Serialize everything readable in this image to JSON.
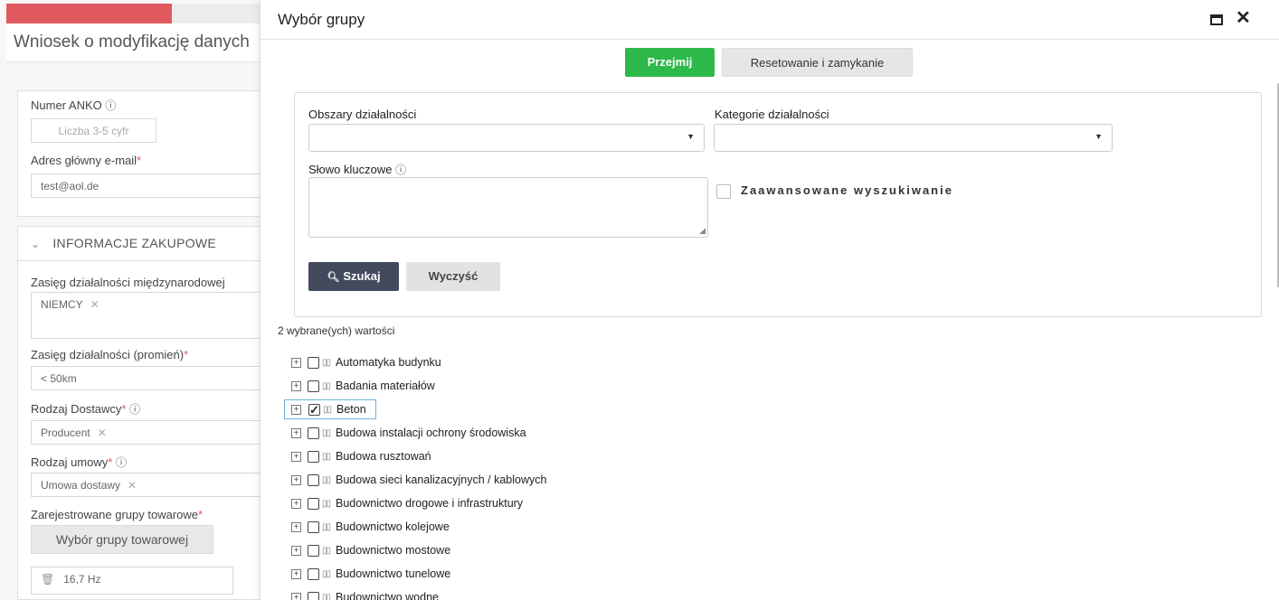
{
  "background_form": {
    "title": "Wniosek o modyfikację danych",
    "fields": {
      "anko_label": "Numer ANKO",
      "anko_placeholder": "Liczba 3-5 cyfr",
      "email_label": "Adres główny e-mail",
      "email_value": "test@aol.de",
      "section_title": "INFORMACJE ZAKUPOWE",
      "intl_label": "Zasięg działalności międzynarodowej",
      "intl_tag": "NIEMCY",
      "radius_label": "Zasięg działalności (promień)",
      "radius_value": "< 50km",
      "supplier_label": "Rodzaj Dostawcy",
      "supplier_tag": "Producent",
      "contract_label": "Rodzaj umowy",
      "contract_tag": "Umowa dostawy",
      "groups_label": "Zarejestrowane grupy towarowe",
      "groups_button": "Wybór grupy towarowej",
      "hz_value": "16,7 Hz"
    },
    "required_mark": "*",
    "info_mark": "ⓘ",
    "remove_mark": "✕"
  },
  "modal": {
    "title": "Wybór grupy",
    "apply_label": "Przejmij",
    "reset_close_label": "Resetowanie i zamykanie",
    "filters": {
      "areas_label": "Obszary działalności",
      "categories_label": "Kategorie działalności",
      "keyword_label": "Słowo kluczowe",
      "advanced_label": "Zaawansowane wyszukiwanie",
      "search_label": "Szukaj",
      "clear_label": "Wyczyść"
    },
    "selected_count_text": "2 wybrane(ych) wartości",
    "tree_items": [
      {
        "label": "Automatyka budynku",
        "checked": false
      },
      {
        "label": "Badania materiałów",
        "checked": false
      },
      {
        "label": "Beton",
        "checked": true
      },
      {
        "label": "Budowa instalacji ochrony środowiska",
        "checked": false
      },
      {
        "label": "Budowa rusztowań",
        "checked": false
      },
      {
        "label": "Budowa sieci kanalizacyjnych / kablowych",
        "checked": false
      },
      {
        "label": "Budownictwo drogowe i infrastruktury",
        "checked": false
      },
      {
        "label": "Budownictwo kolejowe",
        "checked": false
      },
      {
        "label": "Budownictwo mostowe",
        "checked": false
      },
      {
        "label": "Budownictwo tunelowe",
        "checked": false
      },
      {
        "label": "Budownictwo wodne",
        "checked": false
      }
    ]
  },
  "colors": {
    "primary_green": "#2db84a",
    "dark_button": "#434a5e",
    "accent_red": "#e0595f"
  }
}
